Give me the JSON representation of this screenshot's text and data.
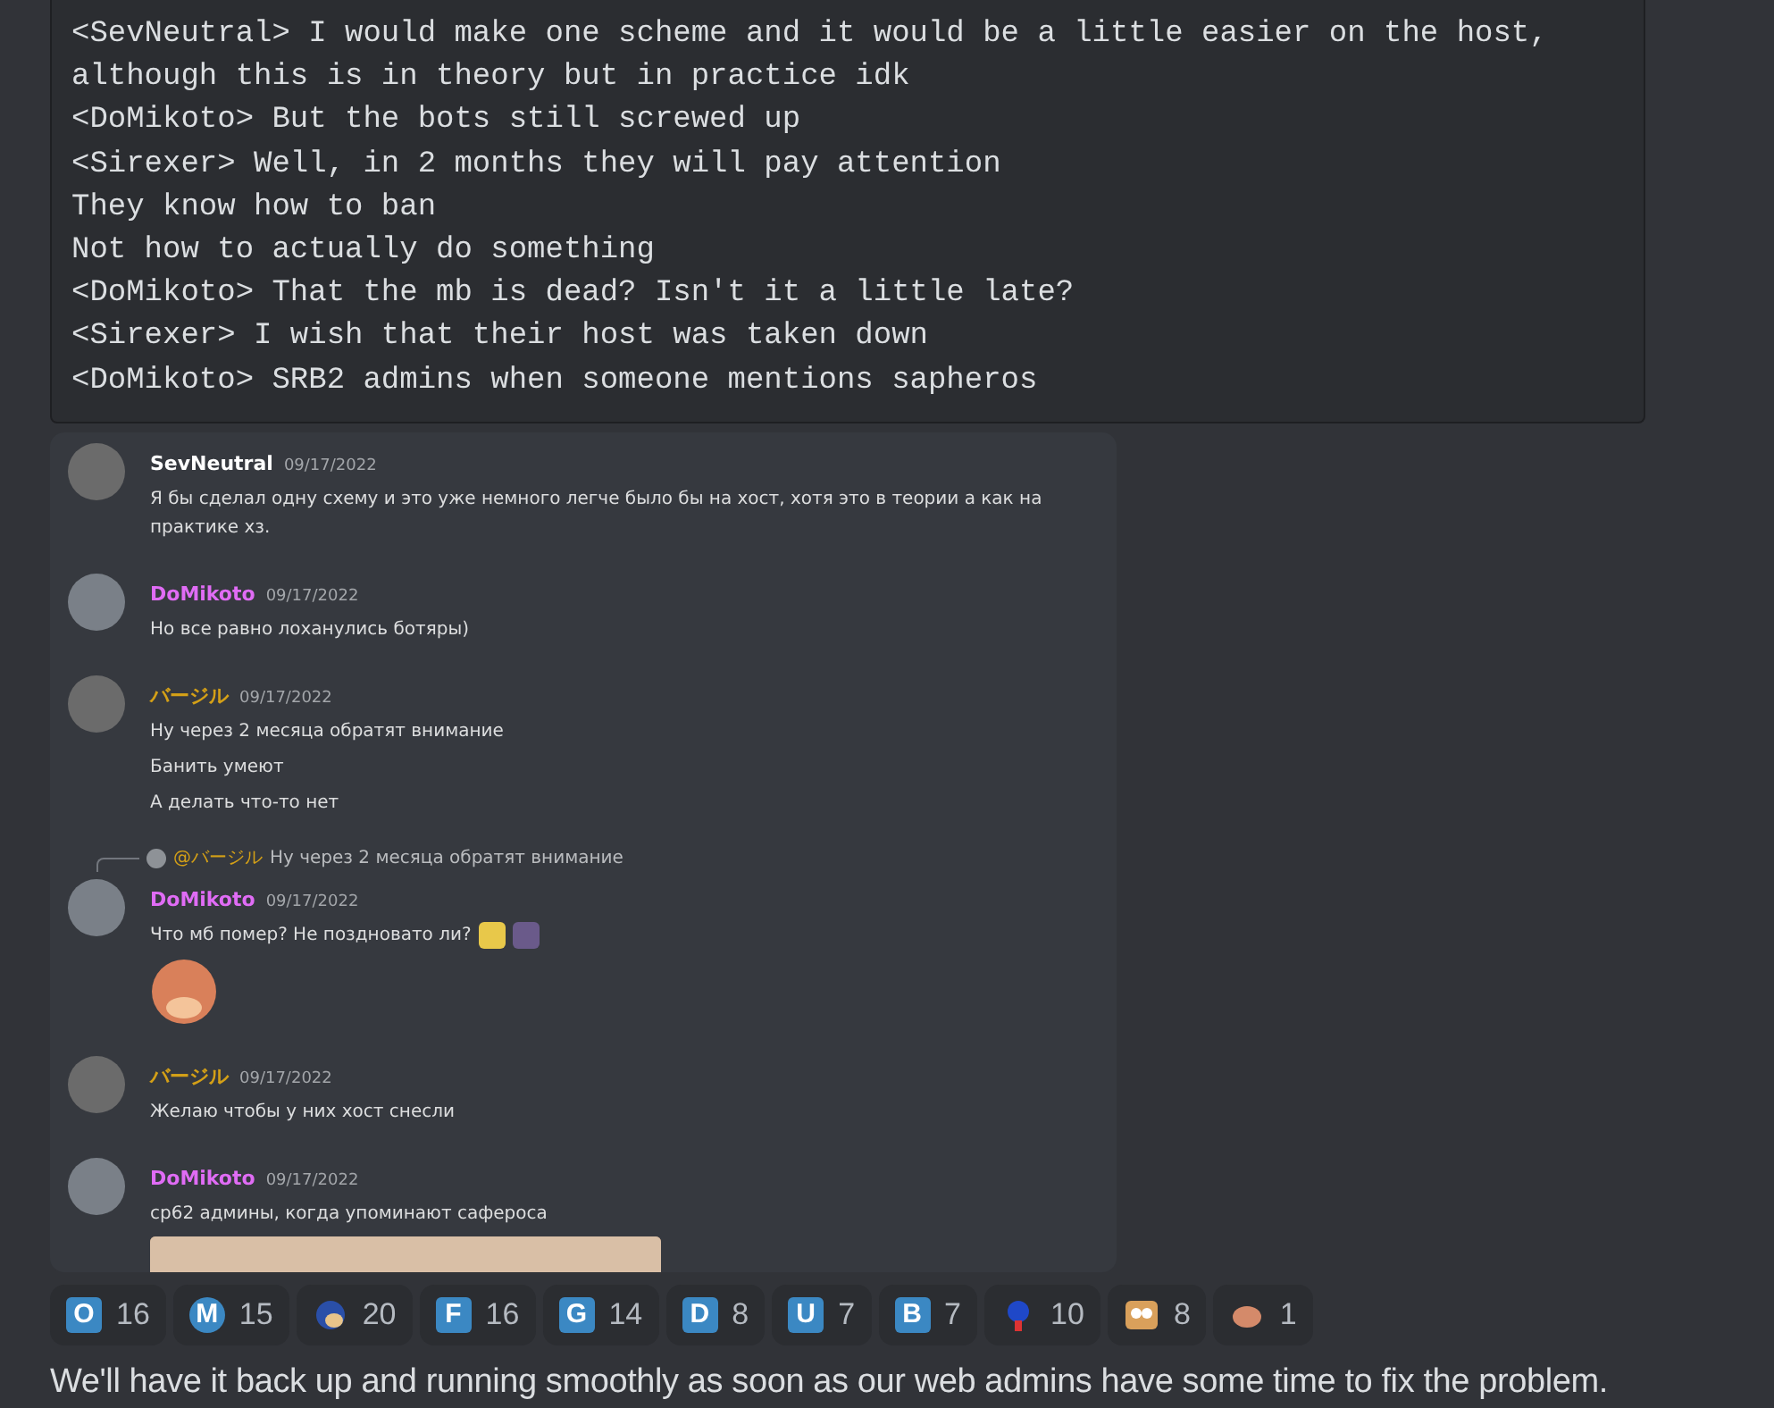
{
  "code_block": {
    "lines": [
      "<SevNeutral> I would make one scheme and it would be a little easier on the host,",
      "although this is in theory but in practice idk",
      "<DoMikoto> But the bots still screwed up",
      "<Sirexer> Well, in 2 months they will pay attention",
      "They know how to ban",
      "Not how to actually do something",
      "<DoMikoto> That the mb is dead? Isn't it a little late?",
      "<Sirexer> I wish that their host was taken down",
      "<DoMikoto> SRB2 admins when someone mentions sapheros"
    ]
  },
  "screenshot": {
    "messages": [
      {
        "author": "SevNeutral",
        "color": "#ffffff",
        "time": "09/17/2022",
        "lines": [
          "Я бы сделал одну схему и это уже немного легче было бы на хост, хотя это в теории а как на практике хз."
        ]
      },
      {
        "author": "DoMikoto",
        "color": "#e06cf5",
        "time": "09/17/2022",
        "lines": [
          "Но все равно лоханулись ботяры)"
        ]
      },
      {
        "author": "バージル",
        "color": "#d4a017",
        "time": "09/17/2022",
        "lines": [
          "Ну через 2 месяца обратят внимание",
          "Банить умеют",
          "А делать что-то нет"
        ]
      },
      {
        "author": "DoMikoto",
        "color": "#e06cf5",
        "time": "09/17/2022",
        "reply": {
          "mention": "@バージル",
          "text": "Ну через 2 месяца обратят внимание"
        },
        "lines": [
          "Что мб помер? Не поздновато ли?"
        ],
        "inline_emojis": true,
        "sticker": true
      },
      {
        "author": "バージル",
        "color": "#d4a017",
        "time": "09/17/2022",
        "lines": [
          "Желаю чтобы у них хост снесли"
        ]
      },
      {
        "author": "DoMikoto",
        "color": "#e06cf5",
        "time": "09/17/2022",
        "lines": [
          "ср62 админы, когда упоминают сафероса"
        ]
      }
    ]
  },
  "reactions": [
    {
      "kind": "letter",
      "letter": "O",
      "count": "16"
    },
    {
      "kind": "round",
      "letter": "M",
      "count": "15"
    },
    {
      "kind": "emoji",
      "count": "20"
    },
    {
      "kind": "letter",
      "letter": "F",
      "count": "16"
    },
    {
      "kind": "letter",
      "letter": "G",
      "count": "14"
    },
    {
      "kind": "letter",
      "letter": "D",
      "count": "8"
    },
    {
      "kind": "letter",
      "letter": "U",
      "count": "7"
    },
    {
      "kind": "letter",
      "letter": "B",
      "count": "7"
    },
    {
      "kind": "emoji",
      "count": "10"
    },
    {
      "kind": "emoji",
      "count": "8"
    },
    {
      "kind": "emoji",
      "count": "1"
    }
  ],
  "message_text": "We'll have it back up and running smoothly as soon as our web admins have some time to fix the problem."
}
